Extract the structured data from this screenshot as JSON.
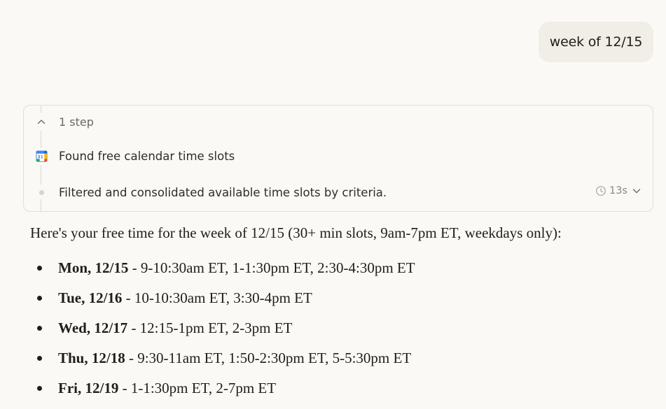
{
  "user_message": "week of 12/15",
  "steps": {
    "count_label": "1 step",
    "items": [
      {
        "icon": "google-calendar-icon",
        "label": "Found free calendar time slots"
      },
      {
        "icon": "dot-icon",
        "label": "Filtered and consolidated available time slots by criteria."
      }
    ],
    "duration": "13s"
  },
  "answer": {
    "intro": "Here's your free time for the week of 12/15 (30+ min slots, 9am-7pm ET, weekdays only):",
    "days": [
      {
        "day": "Mon, 12/15",
        "slots": " - 9-10:30am ET, 1-1:30pm ET, 2:30-4:30pm ET"
      },
      {
        "day": "Tue, 12/16",
        "slots": " - 10-10:30am ET, 3:30-4pm ET"
      },
      {
        "day": "Wed, 12/17",
        "slots": " - 12:15-1pm ET, 2-3pm ET"
      },
      {
        "day": "Thu, 12/18",
        "slots": " - 9:30-11am ET, 1:50-2:30pm ET, 5-5:30pm ET"
      },
      {
        "day": "Fri, 12/19",
        "slots": " - 1-1:30pm ET, 2-7pm ET"
      }
    ]
  }
}
